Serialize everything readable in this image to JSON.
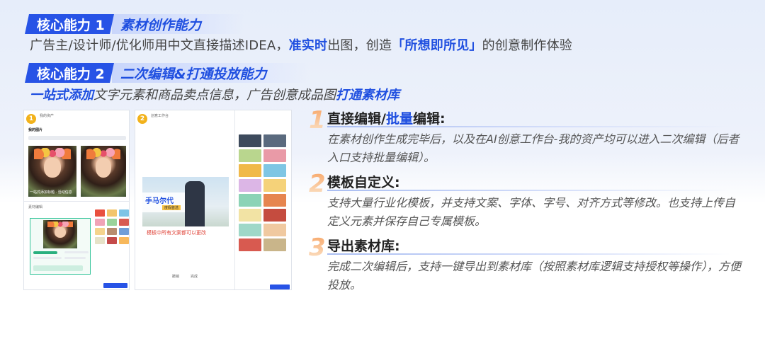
{
  "cap1": {
    "badge": "核心能力 1",
    "title": "素材创作能力"
  },
  "desc1": {
    "pre": "广告主/设计师/优化师用中文直接描述IDEA，",
    "hl1": "准实时",
    "mid": "出图，创造",
    "hl2": "「所想即所见」",
    "post": "的创意制作体验"
  },
  "cap2": {
    "badge": "核心能力 2",
    "title": "二次编辑&打通投放能力"
  },
  "desc2": {
    "hl1": "一站式添加",
    "mid": "文字元素和商品卖点信息，广告创意成品图",
    "hl2": "打通素材库"
  },
  "shot1": {
    "badge": "1",
    "nav": "我的资产",
    "heading": "我的图片",
    "caption": "一站式添加标题 · 活动信息",
    "lower_label": "素材编辑"
  },
  "shot2": {
    "badge": "2",
    "nav": "创意工作台",
    "banner_title": "手马尔代",
    "banner_sub": "度假首选",
    "note": "模板中所有文案都可以更改",
    "footer_left": "撤销",
    "footer_right": "完成"
  },
  "features": [
    {
      "num": "1",
      "title_a": "直接编辑/",
      "title_hl": "批量",
      "title_b": "编辑:",
      "body": "在素材创作生成完毕后，以及在AI创意工作台-我的资产均可以进入二次编辑（后者入口支持批量编辑）。"
    },
    {
      "num": "2",
      "title_a": "模板自定义:",
      "title_hl": "",
      "title_b": "",
      "body": "支持大量行业化模板，并支持文案、字体、字号、对齐方式等修改。也支持上传自定义元素并保存自己专属模板。"
    },
    {
      "num": "3",
      "title_a": "导出素材库:",
      "title_hl": "",
      "title_b": "",
      "body": "完成二次编辑后，支持一键导出到素材库（按照素材库逻辑支持授权等操作），方便投放。"
    }
  ],
  "colors": {
    "accent": "#1f4fe0",
    "badge_bg": "#2753e6",
    "number": "#f8a86b"
  }
}
